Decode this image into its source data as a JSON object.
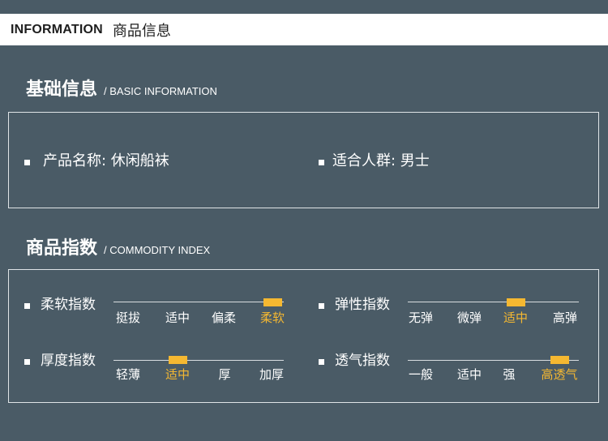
{
  "header": {
    "en": "INFORMATION",
    "cn": "商品信息"
  },
  "basic": {
    "title_cn": "基础信息",
    "title_en": "/ BASIC INFORMATION",
    "product_name": "产品名称: 休闲船袜",
    "audience": "适合人群: 男士"
  },
  "index": {
    "title_cn": "商品指数",
    "title_en": "/ COMMODITY INDEX",
    "items": [
      {
        "label": "柔软指数",
        "options": [
          "挺拔",
          "适中",
          "偏柔",
          "柔软"
        ],
        "selected": "柔软",
        "selected_index": 3
      },
      {
        "label": "弹性指数",
        "options": [
          "无弹",
          "微弹",
          "适中",
          "高弹"
        ],
        "selected": "适中",
        "selected_index": 2
      },
      {
        "label": "厚度指数",
        "options": [
          "轻薄",
          "适中",
          "厚",
          "加厚"
        ],
        "selected": "适中",
        "selected_index": 1
      },
      {
        "label": "透气指数",
        "options": [
          "一般",
          "适中",
          "强",
          "高透气"
        ],
        "selected": "高透气",
        "selected_index": 3
      }
    ]
  },
  "colors": {
    "background": "#4a5b66",
    "accent": "#f5b831",
    "text": "#ffffff"
  }
}
